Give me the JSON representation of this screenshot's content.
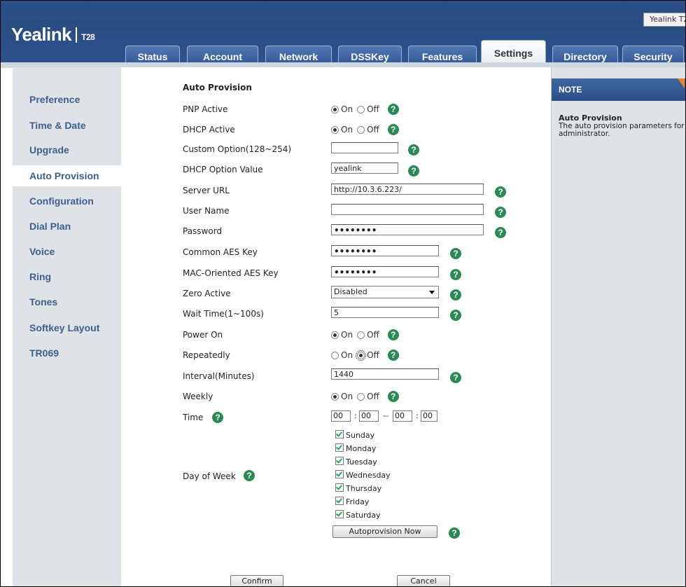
{
  "header": {
    "logo_text": "Yealink",
    "logo_model": "T28",
    "model_badge": "Yealink T2"
  },
  "tabs": [
    {
      "label": "Status"
    },
    {
      "label": "Account"
    },
    {
      "label": "Network"
    },
    {
      "label": "DSSKey"
    },
    {
      "label": "Features"
    },
    {
      "label": "Settings",
      "active": true
    },
    {
      "label": "Directory"
    },
    {
      "label": "Security"
    }
  ],
  "sidebar": {
    "items": [
      {
        "label": "Preference"
      },
      {
        "label": "Time & Date"
      },
      {
        "label": "Upgrade"
      },
      {
        "label": "Auto Provision",
        "active": true
      },
      {
        "label": "Configuration"
      },
      {
        "label": "Dial Plan"
      },
      {
        "label": "Voice"
      },
      {
        "label": "Ring"
      },
      {
        "label": "Tones"
      },
      {
        "label": "Softkey Layout"
      },
      {
        "label": "TR069"
      }
    ]
  },
  "form": {
    "section_title": "Auto Provision",
    "on_label": "On",
    "off_label": "Off",
    "help_glyph": "?",
    "fields": {
      "pnp_active": {
        "label": "PNP Active",
        "value": "On"
      },
      "dhcp_active": {
        "label": "DHCP Active",
        "value": "On"
      },
      "custom_option": {
        "label": "Custom Option(128~254)",
        "value": ""
      },
      "dhcp_option_value": {
        "label": "DHCP Option Value",
        "value": "yealink"
      },
      "server_url": {
        "label": "Server URL",
        "value": "http://10.3.6.223/"
      },
      "user_name": {
        "label": "User Name",
        "value": ""
      },
      "password": {
        "label": "Password",
        "value": "••••••••"
      },
      "common_aes_key": {
        "label": "Common AES Key",
        "value": "••••••••"
      },
      "mac_aes_key": {
        "label": "MAC-Oriented AES Key",
        "value": "••••••••"
      },
      "zero_active": {
        "label": "Zero Active",
        "value": "Disabled"
      },
      "wait_time": {
        "label": "Wait Time(1~100s)",
        "value": "5"
      },
      "power_on": {
        "label": "Power On",
        "value": "On"
      },
      "repeatedly": {
        "label": "Repeatedly",
        "value": "Off"
      },
      "interval": {
        "label": "Interval(Minutes)",
        "value": "1440"
      },
      "weekly": {
        "label": "Weekly",
        "value": "On"
      },
      "time": {
        "label": "Time",
        "start_hour": "00",
        "start_min": "00",
        "end_hour": "00",
        "end_min": "00",
        "colon": ":",
        "dash": "--"
      },
      "day_of_week": {
        "label": "Day of Week",
        "days": [
          "Sunday",
          "Monday",
          "Tuesday",
          "Wednesday",
          "Thursday",
          "Friday",
          "Saturday"
        ]
      }
    },
    "autoprovision_button": "Autoprovision Now",
    "confirm_button": "Confirm",
    "cancel_button": "Cancel"
  },
  "note": {
    "title": "NOTE",
    "subtitle": "Auto Provision",
    "body": "The auto provision parameters for administrator."
  },
  "colors": {
    "header_blue": "#2b4f88",
    "sidebar_bg": "#dfe3e8",
    "sidebar_link": "#3b5f8c",
    "help_green": "#2b8a52",
    "note_accent": "#e8842a"
  }
}
